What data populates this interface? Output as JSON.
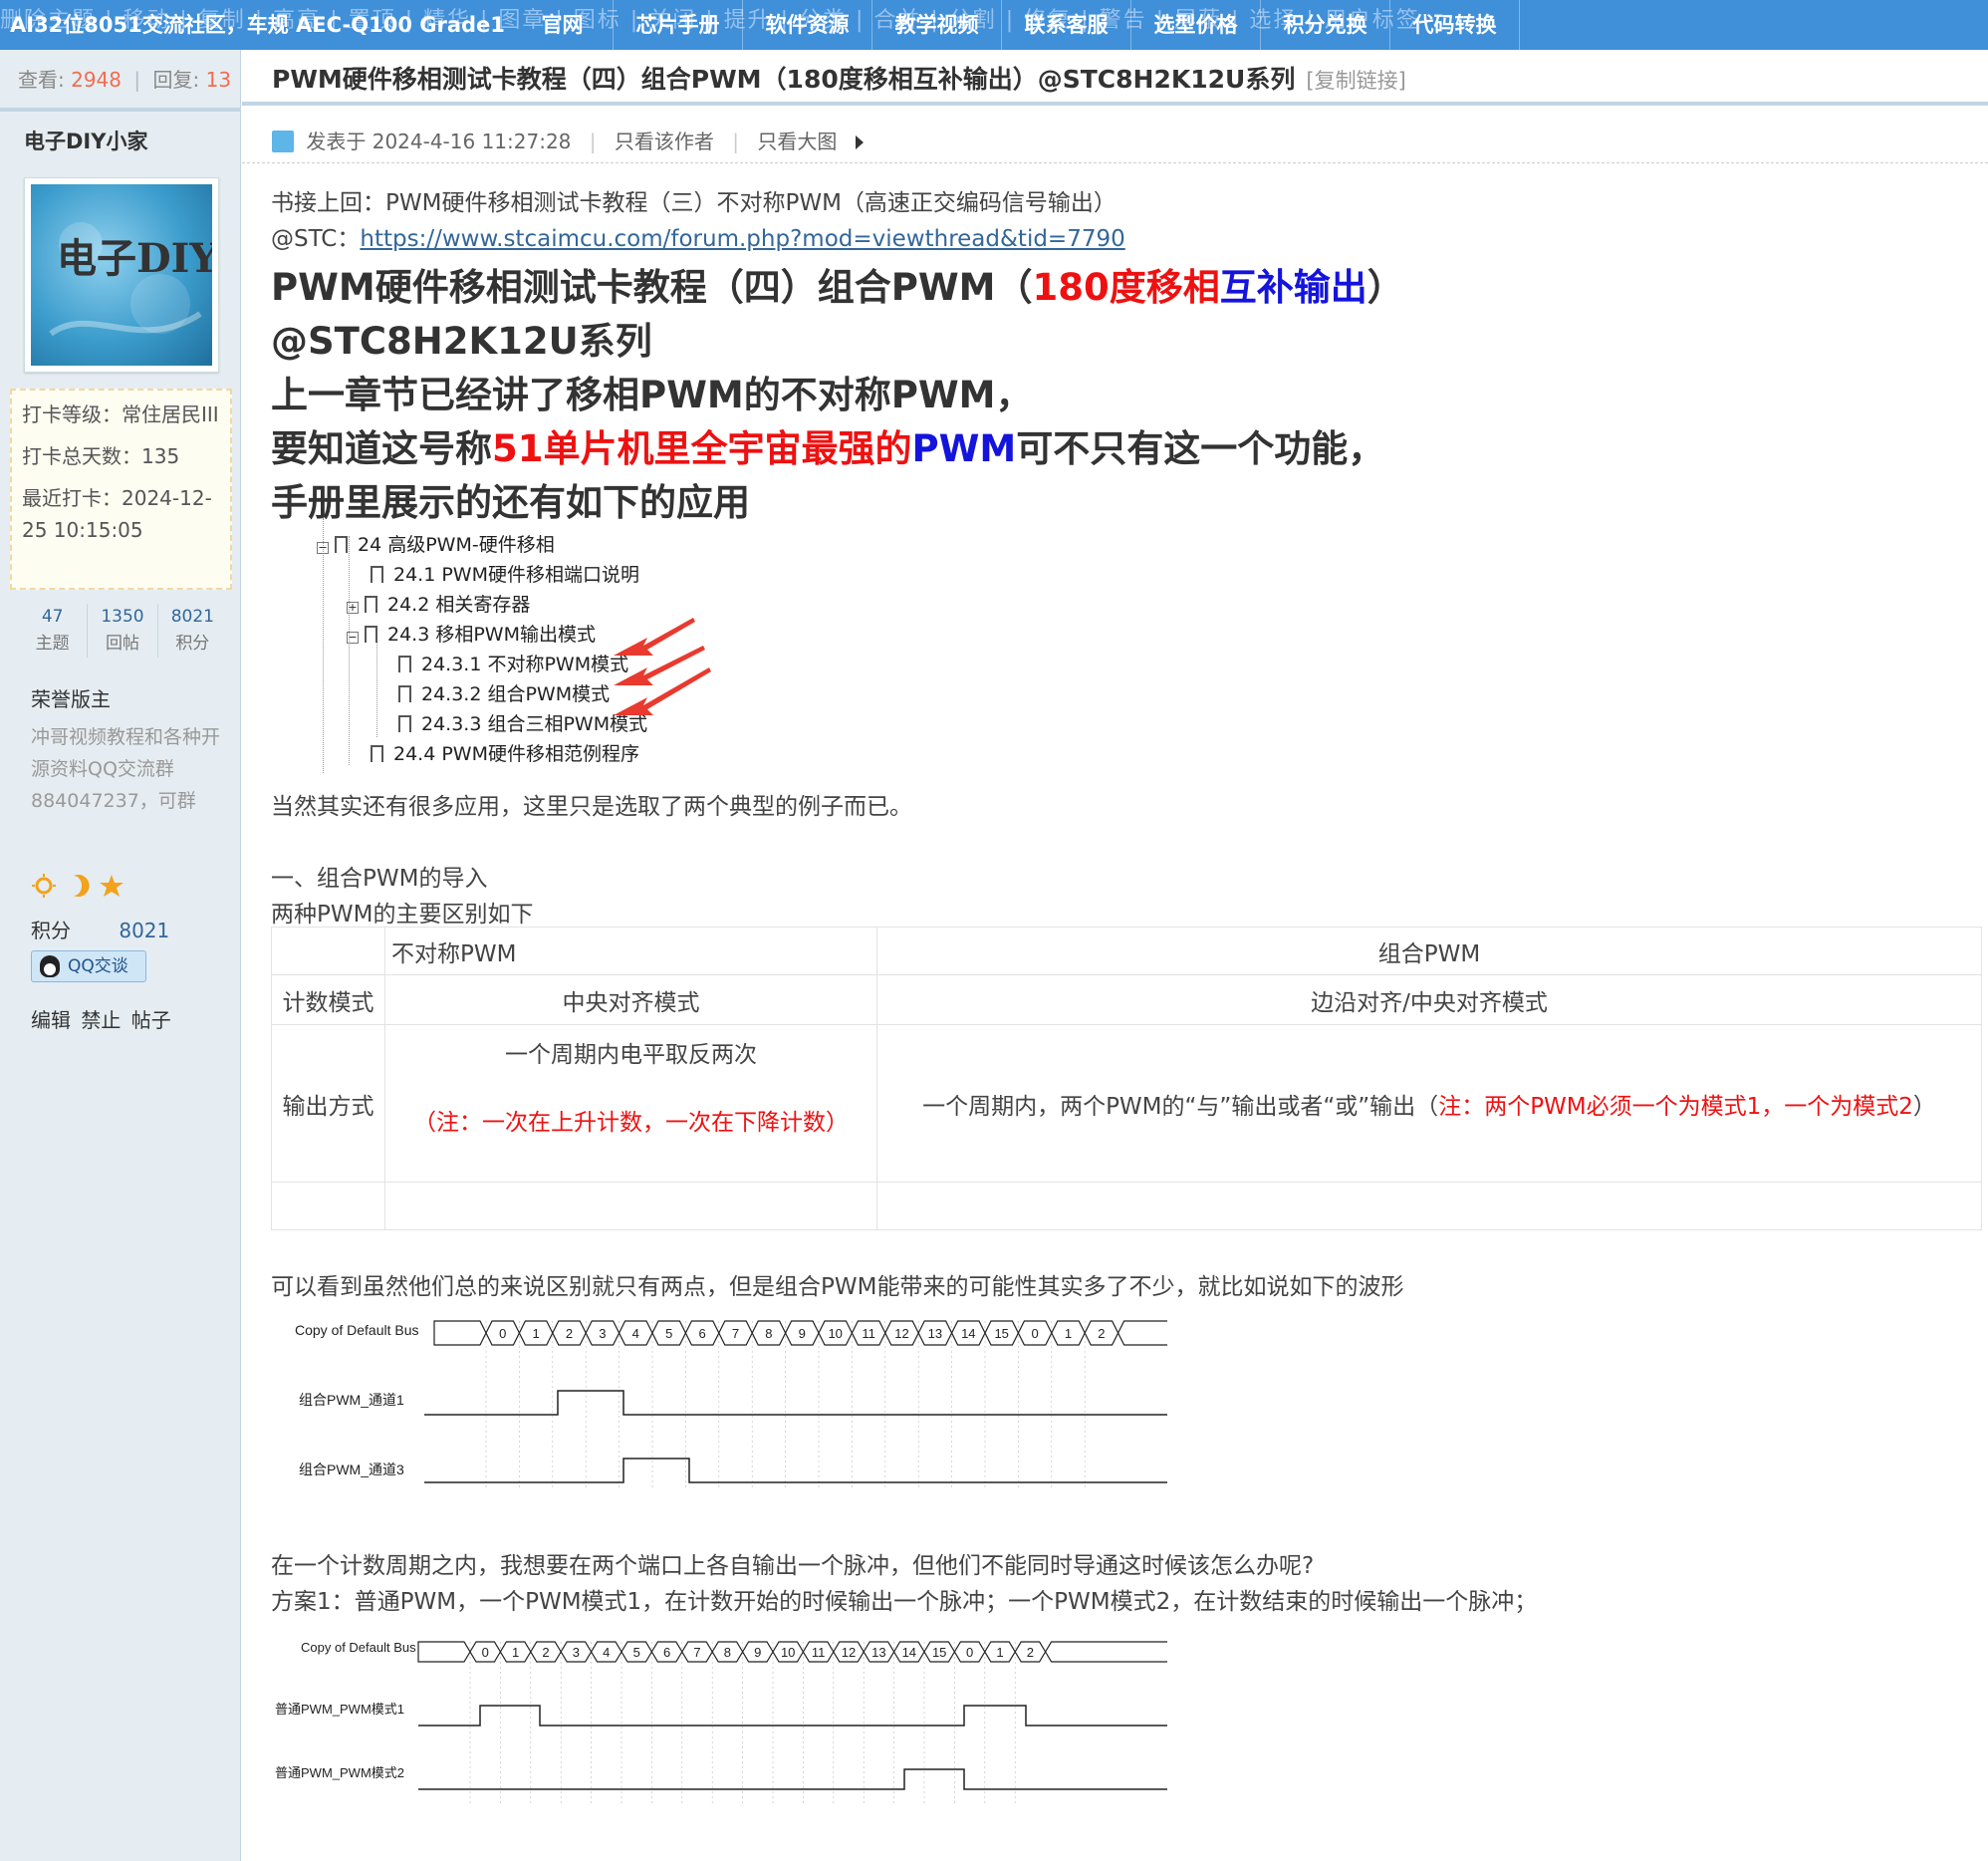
{
  "topbar": {
    "ghost_text": "删除主题 | 移动 | 复制 | 高亮 | 置顶 | 精华 | 图章 | 图标 | 关闭 | 提升 | 分类 | 合并 | 分割 | 修复 | 警告 | 屏蔽 | 选择 | 用户标签",
    "title": "AI32位8051交流社区，车规 AEC-Q100 Grade1",
    "nav": [
      "官网",
      "芯片手册",
      "软件资源",
      "教学视频",
      "联系客服",
      "选型价格",
      "积分兑换",
      "代码转换"
    ]
  },
  "sidebar": {
    "views_label": "查看:",
    "views": "2948",
    "replies_label": "回复:",
    "replies": "13",
    "author": "电子DIY小家",
    "avatar_text": "电子DIY小家",
    "checkin_level": "打卡等级：常住居民III",
    "checkin_days": "打卡总天数：135",
    "checkin_last": "最近打卡：2024-12-25 10:15:05",
    "counts": [
      {
        "value": "47",
        "label": "主题"
      },
      {
        "value": "1350",
        "label": "回帖"
      },
      {
        "value": "8021",
        "label": "积分"
      }
    ],
    "honor": "荣誉版主",
    "qq_desc": "冲哥视频教程和各种开源资料QQ交流群884047237，可群",
    "credit_label": "积分",
    "credit_value": "8021",
    "qq_button": "QQ交谈",
    "admin_links": "编辑 禁止 帖子"
  },
  "thread": {
    "title": "PWM硬件移相测试卡教程（四）组合PWM（180度移相互补输出）@STC8H2K12U系列",
    "copy_link": "[复制链接]",
    "posted": "发表于 2024-4-16 11:27:28",
    "only_author": "只看该作者",
    "only_big_images": "只看大图"
  },
  "post": {
    "intro1": "书接上回：PWM硬件移相测试卡教程（三）不对称PWM（高速正交编码信号输出）",
    "intro2_prefix": "@STC：",
    "intro2_link": "https://www.stcaimcu.com/forum.php?mod=viewthread&tid=7790",
    "h_line1_a": "PWM硬件移相测试卡教程（四）组合PWM（",
    "h_line1_red": "180度移相",
    "h_line1_blue": "互补输出",
    "h_line1_b": "）",
    "h_line2": "@STC8H2K12U系列",
    "h_line3": "上一章节已经讲了移相PWM的不对称PWM，",
    "h_line4_a": "要知道这号称",
    "h_line4_red": "51单片机里全宇宙最强的",
    "h_line4_blue": "PWM",
    "h_line4_b": "可不只有这一个功能，",
    "h_line5": "手册里展示的还有如下的应用",
    "toc": [
      "24 高级PWM-硬件移相",
      "24.1 PWM硬件移相端口说明",
      "24.2 相关寄存器",
      "24.3 移相PWM输出模式",
      "24.3.1 不对称PWM模式",
      "24.3.2 组合PWM模式",
      "24.3.3 组合三相PWM模式",
      "24.4 PWM硬件移相范例程序"
    ],
    "after_toc": "当然其实还有很多应用，这里只是选取了两个典型的例子而已。",
    "section1": "一、组合PWM的导入",
    "section1_sub": "两种PWM的主要区别如下",
    "table": {
      "h_col1": "不对称PWM",
      "h_col2": "组合PWM",
      "r1_label": "计数模式",
      "r1_c1": "中央对齐模式",
      "r1_c2": "边沿对齐/中央对齐模式",
      "r2_label": "输出方式",
      "r2_c1_line1": "一个周期内电平取反两次",
      "r2_c1_note": "（注：一次在上升计数，一次在下降计数）",
      "r2_c2_text": "一个周期内，两个PWM的“与”输出或者“或”输出（",
      "r2_c2_note": "注：两个PWM必须一个为模式1，一个为模式2",
      "r2_c2_close": "）"
    },
    "wave_intro": "可以看到虽然他们总的来说区别就只有两点，但是组合PWM能带来的可能性其实多了不少，就比如说如下的波形",
    "wave1": {
      "bus_label": "Copy of Default Bus",
      "ch1_label": "组合PWM_通道1",
      "ch2_label": "组合PWM_通道3",
      "bus_values": [
        "0",
        "1",
        "2",
        "3",
        "4",
        "5",
        "6",
        "7",
        "8",
        "9",
        "10",
        "11",
        "12",
        "13",
        "14",
        "15",
        "0",
        "1",
        "2"
      ]
    },
    "q_line": "在一个计数周期之内，我想要在两个端口上各自输出一个脉冲，但他们不能同时导通这时候该怎么办呢?",
    "plan1": "方案1：普通PWM，一个PWM模式1，在计数开始的时候输出一个脉冲；一个PWM模式2，在计数结束的时候输出一个脉冲；",
    "wave2": {
      "bus_label": "Copy of Default Bus",
      "ch1_label": "普通PWM_PWM模式1",
      "ch2_label": "普通PWM_PWM模式2",
      "bus_values": [
        "0",
        "1",
        "2",
        "3",
        "4",
        "5",
        "6",
        "7",
        "8",
        "9",
        "10",
        "11",
        "12",
        "13",
        "14",
        "15",
        "0",
        "1",
        "2"
      ]
    }
  },
  "colors": {
    "nav_bg": "#3f8fd9",
    "sidebar_bg": "#e5edf2",
    "accent_red": "#ee1111",
    "accent_blue": "#1414dd",
    "link": "#336699"
  }
}
